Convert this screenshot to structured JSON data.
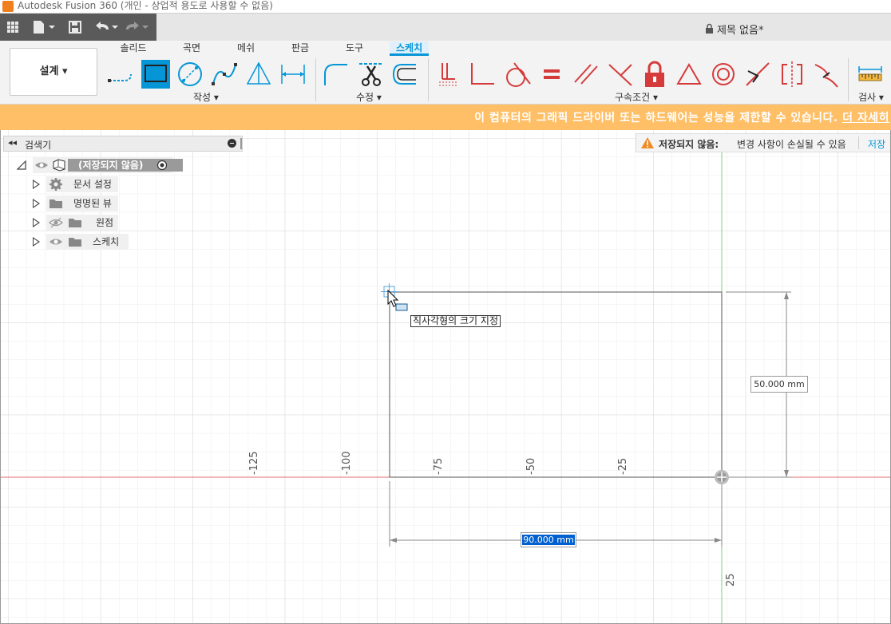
{
  "window": {
    "title": "Autodesk Fusion 360 (개인 - 상업적 용도로 사용할 수 없음)"
  },
  "document": {
    "title": "제목 없음*"
  },
  "workspace": {
    "label": "설계"
  },
  "tabs": [
    {
      "label": "솔리드",
      "active": false
    },
    {
      "label": "곡면",
      "active": false
    },
    {
      "label": "메쉬",
      "active": false
    },
    {
      "label": "판금",
      "active": false
    },
    {
      "label": "도구",
      "active": false
    },
    {
      "label": "스케치",
      "active": true
    }
  ],
  "groups": {
    "create": "작성",
    "modify": "수정",
    "constraints": "구속조건",
    "inspect": "검사"
  },
  "warning_banner": {
    "text": "이 컴퓨터의 그래픽 드라이버 또는 하드웨어는 성능을 제한할 수 있습니다.",
    "link": "더 자세히"
  },
  "browser": {
    "header": "검색기",
    "root": "(저장되지 않음)",
    "items": [
      {
        "label": "문서 설정",
        "icon": "gear-icon"
      },
      {
        "label": "명명된 뷰",
        "icon": "folder-icon"
      },
      {
        "label": "원점",
        "icon": "folder-icon"
      },
      {
        "label": "스케치",
        "icon": "folder-icon"
      }
    ]
  },
  "unsaved": {
    "label": "저장되지 않음:",
    "detail": "변경 사항이 손실될 수 있음",
    "save": "저장"
  },
  "sketch": {
    "tooltip": "직사각형의 크기 지정",
    "width_value": "90.000 mm",
    "height_value": "50.000 mm",
    "axis_labels_x": [
      "-125",
      "-100",
      "-75",
      "-50",
      "-25"
    ],
    "axis_labels_y": [
      "25"
    ]
  },
  "colors": {
    "accent": "#0696d7",
    "warning": "#ffbf66",
    "constraint_red": "#d63b3b",
    "x_axis": "#e07070",
    "y_axis": "#7cd07c"
  }
}
